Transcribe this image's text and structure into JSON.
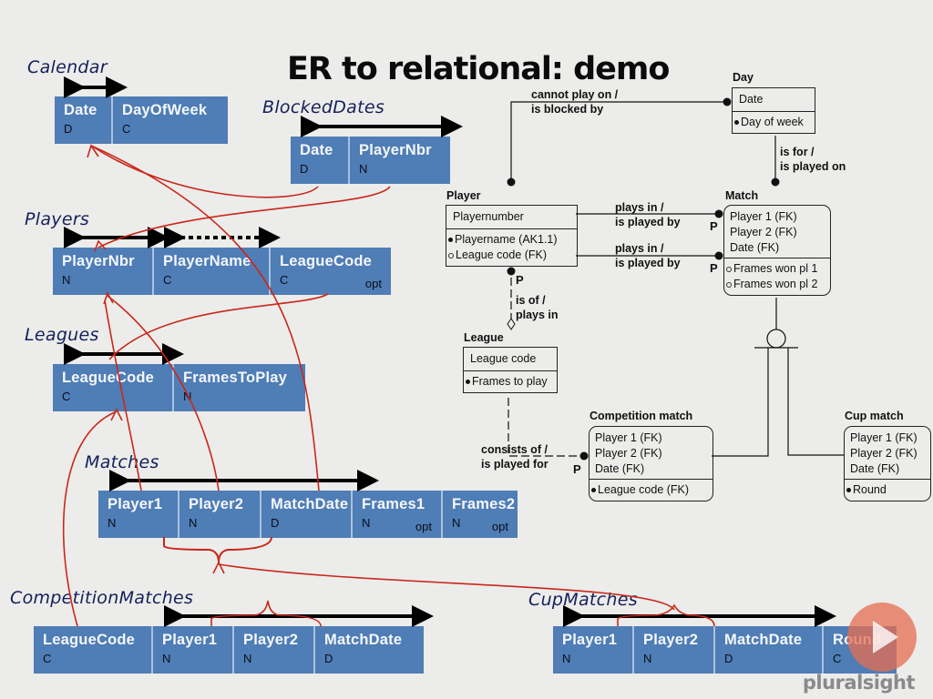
{
  "title": "ER to relational: demo",
  "relations": {
    "calendar": {
      "name": "Calendar",
      "columns": [
        {
          "name": "Date",
          "type": "D",
          "opt": ""
        },
        {
          "name": "DayOfWeek",
          "type": "C",
          "opt": ""
        }
      ]
    },
    "blocked_dates": {
      "name": "BlockedDates",
      "columns": [
        {
          "name": "Date",
          "type": "D",
          "opt": ""
        },
        {
          "name": "PlayerNbr",
          "type": "N",
          "opt": ""
        }
      ]
    },
    "players": {
      "name": "Players",
      "columns": [
        {
          "name": "PlayerNbr",
          "type": "N",
          "opt": ""
        },
        {
          "name": "PlayerName",
          "type": "C",
          "opt": ""
        },
        {
          "name": "LeagueCode",
          "type": "C",
          "opt": "opt"
        }
      ]
    },
    "leagues": {
      "name": "Leagues",
      "columns": [
        {
          "name": "LeagueCode",
          "type": "C",
          "opt": ""
        },
        {
          "name": "FramesToPlay",
          "type": "N",
          "opt": ""
        }
      ]
    },
    "matches": {
      "name": "Matches",
      "columns": [
        {
          "name": "Player1",
          "type": "N",
          "opt": ""
        },
        {
          "name": "Player2",
          "type": "N",
          "opt": ""
        },
        {
          "name": "MatchDate",
          "type": "D",
          "opt": ""
        },
        {
          "name": "Frames1",
          "type": "N",
          "opt": "opt"
        },
        {
          "name": "Frames2",
          "type": "N",
          "opt": "opt"
        }
      ]
    },
    "competition_matches": {
      "name": "CompetitionMatches",
      "columns": [
        {
          "name": "LeagueCode",
          "type": "C",
          "opt": ""
        },
        {
          "name": "Player1",
          "type": "N",
          "opt": ""
        },
        {
          "name": "Player2",
          "type": "N",
          "opt": ""
        },
        {
          "name": "MatchDate",
          "type": "D",
          "opt": ""
        }
      ]
    },
    "cup_matches": {
      "name": "CupMatches",
      "columns": [
        {
          "name": "Player1",
          "type": "N",
          "opt": ""
        },
        {
          "name": "Player2",
          "type": "N",
          "opt": ""
        },
        {
          "name": "MatchDate",
          "type": "D",
          "opt": ""
        },
        {
          "name": "Round",
          "type": "C",
          "opt": ""
        }
      ]
    }
  },
  "er": {
    "day": {
      "name": "Day",
      "key": [
        "Date"
      ],
      "attrs": [
        {
          "marker": "mandatory",
          "text": "Day of week"
        }
      ]
    },
    "player": {
      "name": "Player",
      "key": [
        "Playernumber"
      ],
      "attrs": [
        {
          "marker": "mandatory",
          "text": "Playername (AK1.1)"
        },
        {
          "marker": "optional",
          "text": "League code (FK)"
        }
      ]
    },
    "match": {
      "name": "Match",
      "key": [
        "Player 1 (FK)",
        "Player 2 (FK)",
        "Date (FK)"
      ],
      "attrs": [
        {
          "marker": "optional",
          "text": "Frames won pl 1"
        },
        {
          "marker": "optional",
          "text": "Frames won pl 2"
        }
      ]
    },
    "league": {
      "name": "League",
      "key": [
        "League code"
      ],
      "attrs": [
        {
          "marker": "mandatory",
          "text": "Frames to play"
        }
      ]
    },
    "competition_match": {
      "name": "Competition match",
      "key": [
        "Player 1 (FK)",
        "Player 2 (FK)",
        "Date (FK)"
      ],
      "attrs": [
        {
          "marker": "mandatory",
          "text": "League code (FK)"
        }
      ]
    },
    "cup_match": {
      "name": "Cup match",
      "key": [
        "Player 1 (FK)",
        "Player 2 (FK)",
        "Date (FK)"
      ],
      "attrs": [
        {
          "marker": "mandatory",
          "text": "Round"
        }
      ]
    },
    "relationships": {
      "cannot_play_on": [
        "cannot play on /",
        "is blocked by"
      ],
      "is_for": [
        "is for /",
        "is played on"
      ],
      "plays_in_1": [
        "plays in /",
        "is played by"
      ],
      "plays_in_2": [
        "plays in /",
        "is played by"
      ],
      "is_of": [
        "is of /",
        "plays in"
      ],
      "consists_of": [
        "consists of /",
        "is played for"
      ]
    },
    "p_marker": "P"
  },
  "branding": {
    "logo": "pluralsight",
    "play_icon": "play-icon"
  }
}
